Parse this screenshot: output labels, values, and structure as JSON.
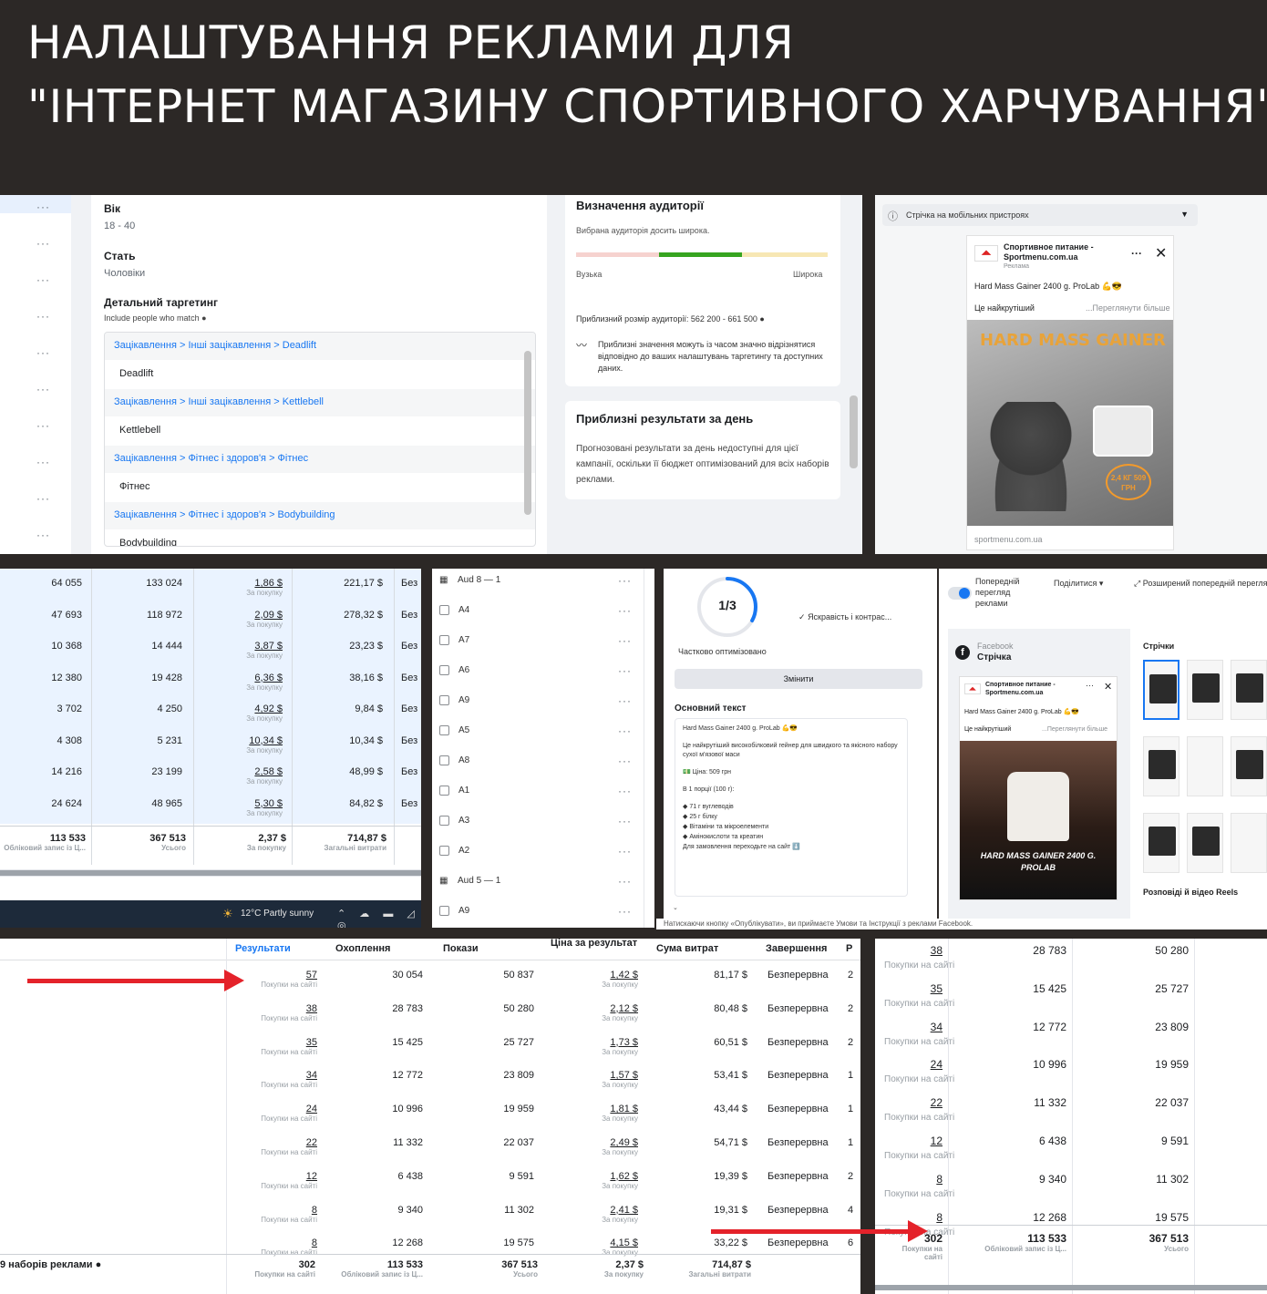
{
  "header": {
    "line1": "НАЛАШТУВАННЯ РЕКЛАМИ  ДЛЯ",
    "line2": "\"ІНТЕРНЕТ МАГАЗИНУ СПОРТИВНОГО ХАРЧУВАННЯ\""
  },
  "targeting": {
    "age_label": "Вік",
    "age_value": "18 - 40",
    "gender_label": "Стать",
    "gender_value": "Чоловіки",
    "detailed_label": "Детальний таргетинг",
    "include_label": "Include people who match",
    "items": [
      {
        "path": "Зацікавлення > Інші зацікавлення > Deadlift",
        "name": "Deadlift"
      },
      {
        "path": "Зацікавлення > Інші зацікавлення > Kettlebell",
        "name": "Kettlebell"
      },
      {
        "path": "Зацікавлення > Фітнес і здоров'я > Фітнес",
        "name": "Фітнес"
      },
      {
        "path": "Зацікавлення > Фітнес і здоров'я > Bodybuilding",
        "name": "Bodybuilding"
      }
    ]
  },
  "audience": {
    "title": "Визначення аудиторії",
    "subtitle": "Вибрана аудиторія досить широка.",
    "narrow": "Вузька",
    "wide": "Широка",
    "size": "Приблизний розмір аудиторії: 562 200 - 661 500",
    "note": "Приблизні значення можуть із часом значно відрізнятися відповідно до ваших налаштувань таргетингу та доступних даних.",
    "results_title": "Приблизні результати за день",
    "results_text": "Прогнозовані результати за день недоступні для цієї кампанії, оскільки її бюджет оптимізований для всіх наборів реклами."
  },
  "preview": {
    "placement": "Стрічка на мобільних пристроях",
    "page_name": "Спортивное питание - Sportmenu.com.ua",
    "sponsored": "Реклама",
    "ad_text": "Hard Mass Gainer 2400 g. ProLab 💪😎",
    "ad_line2": "Це найкрутіший",
    "see_more": "...Переглянути більше",
    "product_title": "HARD MASS GAINER",
    "price": "2,4 КГ 509 ГРН",
    "domain": "sportmenu.com.ua"
  },
  "table1": {
    "rows": [
      {
        "reach": "64 055",
        "impr": "133 024",
        "cpr": "1,86 $",
        "spent": "221,17 $"
      },
      {
        "reach": "47 693",
        "impr": "118 972",
        "cpr": "2,09 $",
        "spent": "278,32 $"
      },
      {
        "reach": "10 368",
        "impr": "14 444",
        "cpr": "3,87 $",
        "spent": "23,23 $"
      },
      {
        "reach": "12 380",
        "impr": "19 428",
        "cpr": "6,36 $",
        "spent": "38,16 $"
      },
      {
        "reach": "3 702",
        "impr": "4 250",
        "cpr": "4,92 $",
        "spent": "9,84 $"
      },
      {
        "reach": "4 308",
        "impr": "5 231",
        "cpr": "10,34 $",
        "spent": "10,34 $"
      },
      {
        "reach": "14 216",
        "impr": "23 199",
        "cpr": "2,58 $",
        "spent": "48,99 $"
      },
      {
        "reach": "24 624",
        "impr": "48 965",
        "cpr": "5,30 $",
        "spent": "84,82 $"
      }
    ],
    "per_purchase": "За покупку",
    "status_cut": "Без",
    "total": {
      "reach": "113 533",
      "impr": "367 513",
      "cpr": "2,37 $",
      "spent": "714,87 $"
    },
    "total_sub": {
      "reach": "Обліковий запис із Ц...",
      "impr": "Усього",
      "cpr": "За покупку",
      "spent": "Загальні витрати"
    },
    "taskbar_weather": "12°C  Partly sunny"
  },
  "adlist": {
    "items": [
      "Aud 8 — 1",
      "A4",
      "A7",
      "A6",
      "A9",
      "A5",
      "A8",
      "A1",
      "A3",
      "A2",
      "Aud 5 — 1",
      "A9"
    ]
  },
  "creative": {
    "progress": "1/3",
    "progress_value": 0.33,
    "progress_label": "Частково оптимізовано",
    "check": "Яскравість і контрас...",
    "change_button": "Змінити",
    "primary_text_label": "Основний текст",
    "text_lines": [
      "Hard Mass Gainer 2400 g. ProLab 💪😎",
      "Це найкрутіший високобілковий гейнер для швидкого та якісного набору сухої м'язової маси",
      "💵 Ціна: 509 грн",
      "В 1 порції (100 г):",
      "◆ 71 г вуглеводів",
      "◆ 25 г білку",
      "◆ Вітаміни та мікроелементи",
      "◆ Амінокислоти та креатин",
      "Для замовлення переходьте на сайт ⬇️"
    ],
    "footer": "Натискаючи кнопку «Опублікувати», ви приймаєте Умови та Інструкції з реклами Facebook."
  },
  "preview2": {
    "toggle_label": "Попередній перегляд реклами",
    "share": "Поділитися",
    "advanced": "Розширений попередній перегляд",
    "fb_label": "Facebook",
    "feed_label": "Стрічка",
    "feeds_col": "Стрічки",
    "stories_col": "Розповіді й відео Reels",
    "page_name": "Спортивное питание - Sportmenu.com.ua",
    "ad_text": "Hard Mass Gainer 2400 g. ProLab 💪😎",
    "ad_line2": "Це найкрутіший",
    "see_more": "...Переглянути більше",
    "product_title": "HARD MASS GAINER 2400 G. PROLAB"
  },
  "table2": {
    "headers": [
      "Результати",
      "Охоплення",
      "Покази",
      "Ціна за результат",
      "Сума витрат",
      "Завершення",
      "Р"
    ],
    "result_sub": "Покупки на сайті",
    "cpr_sub": "За покупку",
    "status": "Безперервна",
    "rows": [
      {
        "res": "57",
        "reach": "30 054",
        "impr": "50 837",
        "cpr": "1,42 $",
        "spent": "81,17 $",
        "end": "2"
      },
      {
        "res": "38",
        "reach": "28 783",
        "impr": "50 280",
        "cpr": "2,12 $",
        "spent": "80,48 $",
        "end": "2"
      },
      {
        "res": "35",
        "reach": "15 425",
        "impr": "25 727",
        "cpr": "1,73 $",
        "spent": "60,51 $",
        "end": "2"
      },
      {
        "res": "34",
        "reach": "12 772",
        "impr": "23 809",
        "cpr": "1,57 $",
        "spent": "53,41 $",
        "end": "1"
      },
      {
        "res": "24",
        "reach": "10 996",
        "impr": "19 959",
        "cpr": "1,81 $",
        "spent": "43,44 $",
        "end": "1"
      },
      {
        "res": "22",
        "reach": "11 332",
        "impr": "22 037",
        "cpr": "2,49 $",
        "spent": "54,71 $",
        "end": "1"
      },
      {
        "res": "12",
        "reach": "6 438",
        "impr": "9 591",
        "cpr": "1,62 $",
        "spent": "19,39 $",
        "end": "2"
      },
      {
        "res": "8",
        "reach": "9 340",
        "impr": "11 302",
        "cpr": "2,41 $",
        "spent": "19,31 $",
        "end": "4"
      },
      {
        "res": "8",
        "reach": "12 268",
        "impr": "19 575",
        "cpr": "4,15 $",
        "spent": "33,22 $",
        "end": "6"
      }
    ],
    "total_label": "9 наборів реклами",
    "total": {
      "res": "302",
      "reach": "113 533",
      "impr": "367 513",
      "cpr": "2,37 $",
      "spent": "714,87 $"
    },
    "total_sub": {
      "res": "Покупки на сайті",
      "reach": "Обліковий запис із Ц...",
      "impr": "Усього",
      "cpr": "За покупку",
      "spent": "Загальні витрати"
    }
  },
  "table3": {
    "rows": [
      {
        "res": "38",
        "reach": "28 783",
        "impr": "50 280"
      },
      {
        "res": "35",
        "reach": "15 425",
        "impr": "25 727"
      },
      {
        "res": "34",
        "reach": "12 772",
        "impr": "23 809"
      },
      {
        "res": "24",
        "reach": "10 996",
        "impr": "19 959"
      },
      {
        "res": "22",
        "reach": "11 332",
        "impr": "22 037"
      },
      {
        "res": "12",
        "reach": "6 438",
        "impr": "9 591"
      },
      {
        "res": "8",
        "reach": "9 340",
        "impr": "11 302"
      },
      {
        "res": "8",
        "reach": "12 268",
        "impr": "19 575"
      }
    ],
    "sub": "Покупки на сайті",
    "total": {
      "res": "302",
      "reach": "113 533",
      "impr": "367 513"
    },
    "total_sub": {
      "res": "Покупки на сайті",
      "reach": "Обліковий запис із Ц...",
      "impr": "Усього"
    }
  },
  "colors": {
    "accent": "#1877f2",
    "arrow": "#e4222a",
    "header_bg": "#2c2826",
    "highlight_row": "#eaf3ff"
  }
}
